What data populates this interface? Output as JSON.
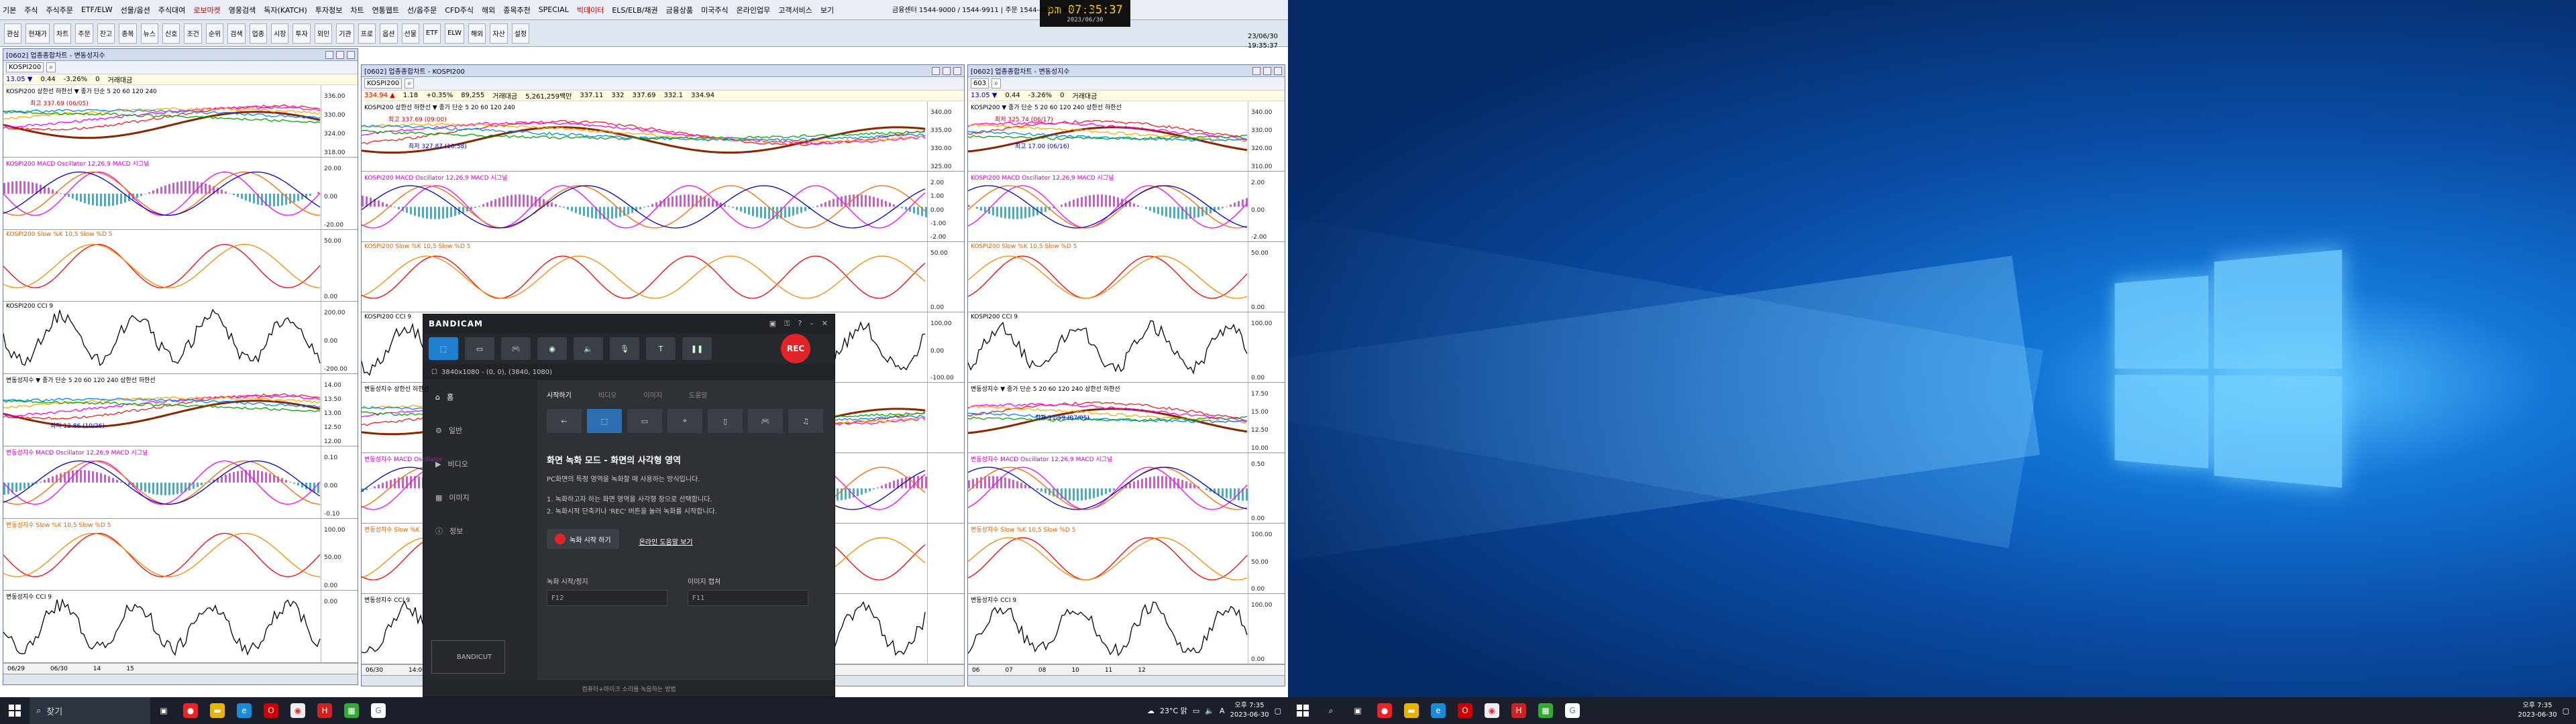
{
  "app": {
    "menu": [
      "기본",
      "주식",
      "주식주문",
      "ETF/ELW",
      "선물/옵션",
      "주식대여",
      "로보마켓",
      "영웅검색",
      "독자(KATCH)",
      "투자정보",
      "차트",
      "연통웹트",
      "선/옵주문",
      "CFD주식",
      "해외",
      "종목추천",
      "SPECIAL",
      "빅데이터",
      "ELS/ELB/채권",
      "금융상품",
      "미국주식",
      "온라인업무",
      "고객서비스",
      "보기"
    ],
    "top_right": "금융센터 1544-9000 / 1544-9911 | 주문 1544-4989 | ARS 1544-",
    "time": "pm 07:35:37",
    "time_date": "2023/06/30",
    "side_date": "23/06/30",
    "side_time": "19:35:37",
    "toolbar": [
      "관심",
      "현재가",
      "차트",
      "주문",
      "잔고",
      "종목",
      "뉴스",
      "신호",
      "조건",
      "순위",
      "검색",
      "업종",
      "시장",
      "투자",
      "외인",
      "기관",
      "프로",
      "옵션",
      "선물",
      "ETF",
      "ELW",
      "해외",
      "자산",
      "설정"
    ]
  },
  "windows": {
    "w1": {
      "title": "[0602] 업종종합차트 - 변동성지수",
      "code": "KOSPI200",
      "quote": [
        "13.05 ▼",
        "0.44",
        "-3.26%",
        "0",
        "거래대금"
      ],
      "panels": [
        "KOSPI200 상한선 하한선 ▼ 종가 단순 5 20 60 120 240",
        "KOSPI200 MACD Oscillator 12,26,9  MACD  시그널",
        "KOSPI200 Slow %K 10,5  Slow %D 5",
        "KOSPI200 CCI 9",
        "변동성지수 ▼ 종가 단순 5 20 60 120 240 상한선 하한선",
        "변동성지수 MACD Oscillator 12,26,9  MACD  시그널",
        "변동성지수 Slow %K 10,5  Slow %D 5",
        "변동성지수 CCI 9"
      ],
      "axis1": [
        "336.00",
        "330.00",
        "324.00",
        "318.00"
      ],
      "axis2": [
        "20.00",
        "0.00",
        "-20.00"
      ],
      "axis3": [
        "50.00",
        "0.00"
      ],
      "axis4": [
        "200.00",
        "0.00",
        "-200.00"
      ],
      "axis5": [
        "14.00",
        "13.50",
        "13.00",
        "12.50",
        "12.00"
      ],
      "axis6": [
        "0.10",
        "0.00",
        "-0.10"
      ],
      "axis7": [
        "100.00",
        "50.00",
        "0.00"
      ],
      "axis8": [
        "0.00"
      ],
      "note1": "최고 337.69 (06/05)",
      "note2": "최저 12.86 (10/26)",
      "xdates": [
        "06/29",
        "06/30",
        "14",
        "15"
      ]
    },
    "w2": {
      "title": "[0602] 업종종합차트 - KOSPI200",
      "code": "KOSPI200",
      "quote": [
        "334.94 ▲",
        "1.18",
        "+0.35%",
        "89,255",
        "거래대금",
        "5,261,259백만",
        "337.11",
        "332",
        "337.69",
        "332.1",
        "334.94"
      ],
      "panels": [
        "KOSPI200 상한선 하한선 ▼ 종가 단순 5 20 60 120 240",
        "KOSPI200 MACD Oscillator 12,26,9  MACD  시그널",
        "KOSPI200 Slow %K 10,5  Slow %D 5",
        "KOSPI200 CCI 9",
        "변동성지수 상한선 하한선",
        "변동성지수 MACD Oscillator",
        "변동성지수 Slow %K",
        "변동성지수 CCI 9"
      ],
      "axis1": [
        "340.00",
        "335.00",
        "330.00",
        "325.00"
      ],
      "axis2": [
        "2.00",
        "1.00",
        "0.00",
        "-1.00",
        "-2.00"
      ],
      "axis3": [
        "50.00",
        "0.00"
      ],
      "axis4": [
        "100.00",
        "0.00",
        "-100.00"
      ],
      "note1": "최고 337.69 (09:00)",
      "note2": "최저 327.87 (10:58)",
      "xdates": [
        "06/30",
        "14:00",
        "15:00"
      ]
    },
    "w3": {
      "title": "[0602] 업종종합차트 - 변동성지수",
      "code": "603",
      "quote": [
        "13.05 ▼",
        "0.44",
        "-3.26%",
        "0",
        "거래대금"
      ],
      "panels": [
        "KOSPI200 ▼ 종가 단순 5 20 60 120 240 상한선 하한선",
        "KOSPI200 MACD Oscillator 12,26,9  MACD  시그널",
        "KOSPI200 Slow %K 10,5  Slow %D 5",
        "KOSPI200 CCI 9",
        "변동성지수 ▼ 종가 단순 5 20 60 120 240 상한선 하한선",
        "변동성지수 MACD Oscillator 12,26,9  MACD  시그널",
        "변동성지수 Slow %K 10,5  Slow %D 5",
        "변동성지수 CCI 9"
      ],
      "axis1": [
        "340.00",
        "330.00",
        "320.00",
        "310.00"
      ],
      "axis2": [
        "2.00",
        "0.00",
        "-2.00"
      ],
      "axis3": [
        "50.00",
        "0.00"
      ],
      "axis4": [
        "100.00",
        "0.00"
      ],
      "axis5": [
        "17.50",
        "15.00",
        "12.50",
        "10.00"
      ],
      "axis6": [
        "0.50",
        "0.00"
      ],
      "axis7": [
        "100.00",
        "50.00",
        "0.00"
      ],
      "axis8": [
        "100.00",
        "0.00"
      ],
      "note1": "최저 325.74 (06/17)",
      "note2": "최고 17.00 (06/16)",
      "note3": "최저 11.59 (07/05)",
      "xdates": [
        "06",
        "07",
        "08",
        "10",
        "11",
        "12"
      ]
    }
  },
  "bandicam": {
    "brand": "BANDICAM",
    "resolution": "3840x1080 - (0, 0), (3840, 1080)",
    "rec": "REC",
    "nav": [
      "홈",
      "일반",
      "비디오",
      "이미지",
      "정보"
    ],
    "tabs": [
      "시작하기",
      "비디오",
      "이미지",
      "도움말"
    ],
    "heading": "화면 녹화 모드 - 화면의 사각형 영역",
    "desc": "PC화면의 특정 영역을 녹화할 때 사용하는 방식입니다.",
    "steps": [
      "1. 녹화하고자 하는 화면 영역을 사각형 창으로 선택합니다.",
      "2. 녹화시작 단축키나 'REC' 버튼을 눌러 녹화를 시작합니다."
    ],
    "start_button": "녹화 시작 하기",
    "help_link": "온라인 도움말 보기",
    "hotkey_rec_label": "녹화 시작/정지",
    "hotkey_rec": "F12",
    "hotkey_img_label": "이미지 캡쳐",
    "hotkey_img": "F11",
    "footer": "컴퓨터+마이크 소리를 녹음하는 방법",
    "bandicut": "BANDICUT"
  },
  "taskbar": {
    "search": "찾기",
    "weather": "23°C 맑",
    "lang": "A",
    "time": "오후 7:35",
    "date": "2023-06-30"
  },
  "colors": {
    "accent": "#e2232a",
    "brand": "#1f7fd1"
  }
}
